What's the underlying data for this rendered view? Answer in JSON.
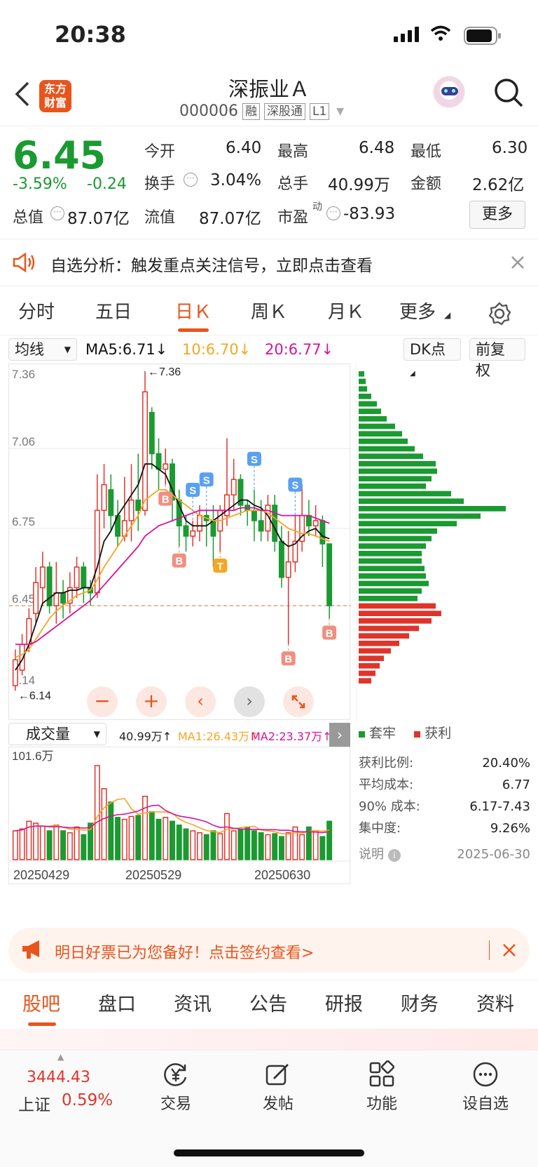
{
  "status": {
    "time": "20:38"
  },
  "header": {
    "title": "深振业Ａ",
    "code": "000006",
    "tags": [
      "融",
      "深股通",
      "L1"
    ],
    "logo_line1": "东方",
    "logo_line2": "财富"
  },
  "quote": {
    "price": "6.45",
    "change_pct": "-3.59%",
    "change": "-0.24",
    "open_label": "今开",
    "open": "6.40",
    "high_label": "最高",
    "high": "6.48",
    "low_label": "最低",
    "low": "6.30",
    "turnover_label": "换手",
    "turnover": "3.04%",
    "volume_label": "总手",
    "volume": "40.99万",
    "amount_label": "金额",
    "amount": "2.62亿",
    "mcap_label": "总值",
    "mcap": "87.07亿",
    "float_label": "流值",
    "float_mcap": "87.07亿",
    "pe_label": "市盈",
    "pe_sup": "动",
    "pe": "-83.93",
    "more": "更多"
  },
  "notice": {
    "text": "自选分析：触发重点关注信号，立即点击查看"
  },
  "tabs": [
    "分时",
    "五日",
    "日Ｋ",
    "周Ｋ",
    "月Ｋ",
    "更多"
  ],
  "indicators": {
    "ma_select": "均线",
    "ma5": "MA5:6.71↓",
    "ma10": "10:6.70↓",
    "ma20": "20:6.77↓",
    "dk": "DK点",
    "fq": "前复权"
  },
  "colors": {
    "up": "#e0342b",
    "down": "#1a9a31",
    "ma5": "#111111",
    "ma10": "#f5a623",
    "ma20": "#d6139a",
    "accent": "#e8551c"
  },
  "chart_data": {
    "type": "candlestick",
    "ylim": [
      6.14,
      7.36
    ],
    "y_ticks": [
      "7.36",
      "7.06",
      "6.75",
      "6.45",
      "6.14"
    ],
    "x_ticks": [
      "20250429",
      "20250529",
      "20250630"
    ],
    "max_marker": "←7.36",
    "min_marker": "←6.14",
    "last_close": 6.45,
    "candles": [
      [
        6.14,
        6.24,
        6.12,
        6.28
      ],
      [
        6.2,
        6.3,
        6.18,
        6.34
      ],
      [
        6.3,
        6.4,
        6.27,
        6.44
      ],
      [
        6.42,
        6.54,
        6.38,
        6.6
      ],
      [
        6.52,
        6.6,
        6.45,
        6.66
      ],
      [
        6.6,
        6.45,
        6.42,
        6.62
      ],
      [
        6.45,
        6.5,
        6.38,
        6.62
      ],
      [
        6.5,
        6.46,
        6.4,
        6.55
      ],
      [
        6.46,
        6.52,
        6.42,
        6.58
      ],
      [
        6.52,
        6.6,
        6.48,
        6.64
      ],
      [
        6.6,
        6.52,
        6.46,
        6.62
      ],
      [
        6.52,
        6.5,
        6.45,
        6.55
      ],
      [
        6.5,
        6.82,
        6.48,
        6.96
      ],
      [
        6.82,
        6.92,
        6.75,
        7.0
      ],
      [
        6.9,
        6.8,
        6.74,
        6.96
      ],
      [
        6.8,
        6.72,
        6.68,
        6.86
      ],
      [
        6.72,
        6.78,
        6.7,
        6.95
      ],
      [
        6.78,
        6.86,
        6.7,
        7.0
      ],
      [
        6.86,
        6.82,
        6.74,
        7.04
      ],
      [
        6.82,
        7.28,
        6.8,
        7.36
      ],
      [
        7.2,
        7.04,
        6.98,
        7.22
      ],
      [
        7.04,
        6.98,
        6.9,
        7.1
      ],
      [
        6.98,
        7.0,
        6.92,
        7.06
      ],
      [
        7.0,
        6.86,
        6.78,
        7.02
      ],
      [
        6.86,
        6.76,
        6.68,
        6.9
      ],
      [
        6.76,
        6.72,
        6.66,
        6.8
      ],
      [
        6.72,
        6.74,
        6.68,
        6.78
      ],
      [
        6.74,
        6.8,
        6.7,
        6.84
      ],
      [
        6.8,
        6.78,
        6.68,
        6.82
      ],
      [
        6.78,
        6.72,
        6.6,
        6.84
      ],
      [
        6.74,
        6.82,
        6.66,
        6.84
      ],
      [
        6.8,
        6.88,
        6.76,
        7.1
      ],
      [
        6.88,
        6.94,
        6.82,
        7.02
      ],
      [
        6.94,
        6.84,
        6.8,
        6.96
      ],
      [
        6.84,
        6.82,
        6.76,
        6.86
      ],
      [
        6.82,
        6.78,
        6.7,
        6.9
      ],
      [
        6.78,
        6.74,
        6.7,
        6.86
      ],
      [
        6.74,
        6.84,
        6.7,
        6.88
      ],
      [
        6.84,
        6.7,
        6.66,
        6.88
      ],
      [
        6.7,
        6.56,
        6.52,
        6.76
      ],
      [
        6.56,
        6.62,
        6.3,
        6.74
      ],
      [
        6.62,
        6.7,
        6.58,
        6.8
      ],
      [
        6.7,
        6.8,
        6.66,
        6.92
      ],
      [
        6.8,
        6.76,
        6.72,
        6.86
      ],
      [
        6.76,
        6.78,
        6.72,
        6.84
      ],
      [
        6.78,
        6.69,
        6.6,
        6.8
      ],
      [
        6.69,
        6.45,
        6.4,
        6.5
      ]
    ],
    "ma5": [
      6.2,
      6.24,
      6.3,
      6.38,
      6.46,
      6.48,
      6.5,
      6.5,
      6.51,
      6.51,
      6.52,
      6.52,
      6.6,
      6.7,
      6.74,
      6.8,
      6.84,
      6.88,
      6.92,
      7.0,
      7.0,
      6.98,
      6.96,
      6.9,
      6.84,
      6.78,
      6.76,
      6.76,
      6.76,
      6.78,
      6.8,
      6.82,
      6.84,
      6.86,
      6.86,
      6.84,
      6.83,
      6.8,
      6.75,
      6.7,
      6.68,
      6.69,
      6.72,
      6.74,
      6.75,
      6.72,
      6.71
    ],
    "ma10": [
      6.25,
      6.26,
      6.28,
      6.32,
      6.36,
      6.4,
      6.43,
      6.45,
      6.47,
      6.49,
      6.5,
      6.51,
      6.55,
      6.6,
      6.64,
      6.68,
      6.72,
      6.76,
      6.8,
      6.86,
      6.88,
      6.9,
      6.9,
      6.88,
      6.86,
      6.84,
      6.82,
      6.8,
      6.79,
      6.78,
      6.78,
      6.79,
      6.8,
      6.81,
      6.82,
      6.82,
      6.82,
      6.81,
      6.79,
      6.77,
      6.75,
      6.74,
      6.73,
      6.73,
      6.72,
      6.71,
      6.7
    ],
    "ma20": [
      6.3,
      6.3,
      6.3,
      6.31,
      6.33,
      6.35,
      6.37,
      6.39,
      6.41,
      6.43,
      6.45,
      6.47,
      6.5,
      6.53,
      6.56,
      6.59,
      6.62,
      6.65,
      6.68,
      6.72,
      6.74,
      6.76,
      6.77,
      6.78,
      6.79,
      6.8,
      6.81,
      6.82,
      6.82,
      6.82,
      6.82,
      6.82,
      6.82,
      6.83,
      6.83,
      6.83,
      6.82,
      6.82,
      6.81,
      6.8,
      6.8,
      6.8,
      6.8,
      6.8,
      6.79,
      6.78,
      6.77
    ],
    "signals": [
      {
        "i": 22,
        "type": "B"
      },
      {
        "i": 24,
        "type": "B"
      },
      {
        "i": 26,
        "type": "S"
      },
      {
        "i": 28,
        "type": "S"
      },
      {
        "i": 30,
        "type": "T"
      },
      {
        "i": 35,
        "type": "S"
      },
      {
        "i": 40,
        "type": "B"
      },
      {
        "i": 41,
        "type": "S"
      },
      {
        "i": 46,
        "type": "B"
      }
    ],
    "signal_labels": [
      "B",
      "S",
      "T"
    ],
    "volume": {
      "title": "成交量",
      "value": "40.99万↑",
      "ma1": "MA1:26.43万↑",
      "ma2": "MA2:23.37万↑",
      "max_label": "101.6万",
      "bars": [
        30,
        32,
        40,
        38,
        35,
        30,
        36,
        30,
        28,
        34,
        26,
        38,
        98,
        74,
        60,
        44,
        42,
        45,
        46,
        66,
        50,
        42,
        44,
        40,
        36,
        32,
        30,
        28,
        26,
        30,
        27,
        48,
        30,
        32,
        34,
        30,
        28,
        26,
        27,
        24,
        28,
        34,
        26,
        34,
        30,
        24,
        40
      ]
    },
    "chips": {
      "trapped": [
        8,
        10,
        12,
        18,
        26,
        32,
        40,
        52,
        62,
        70,
        80,
        92,
        110,
        112,
        104,
        96,
        132,
        150,
        210,
        174,
        140,
        112,
        104,
        96,
        90,
        90,
        94,
        96,
        100,
        90,
        84
      ],
      "profit": [
        110,
        118,
        104,
        86,
        72,
        58,
        46,
        36,
        30,
        24,
        18
      ]
    }
  },
  "dist_legend": {
    "trapped": "套牢",
    "profit": "获利"
  },
  "stats": [
    {
      "label": "获利比例:",
      "value": "20.40%"
    },
    {
      "label": "平均成本:",
      "value": "6.77"
    },
    {
      "label": "90% 成本:",
      "value": "6.17-7.43"
    },
    {
      "label": "集中度:",
      "value": "9.26%"
    },
    {
      "label": "说明",
      "value": "2025-06-30"
    }
  ],
  "ad": {
    "text": "明日好票已为您备好！点击签约查看>"
  },
  "bottom_tabs": [
    "股吧",
    "盘口",
    "资讯",
    "公告",
    "研报",
    "财务",
    "资料"
  ],
  "tabbar": {
    "index_value": "3444.43",
    "index_name": "上证",
    "index_pct": "0.59%",
    "items": [
      "交易",
      "发帖",
      "功能",
      "设自选"
    ]
  }
}
